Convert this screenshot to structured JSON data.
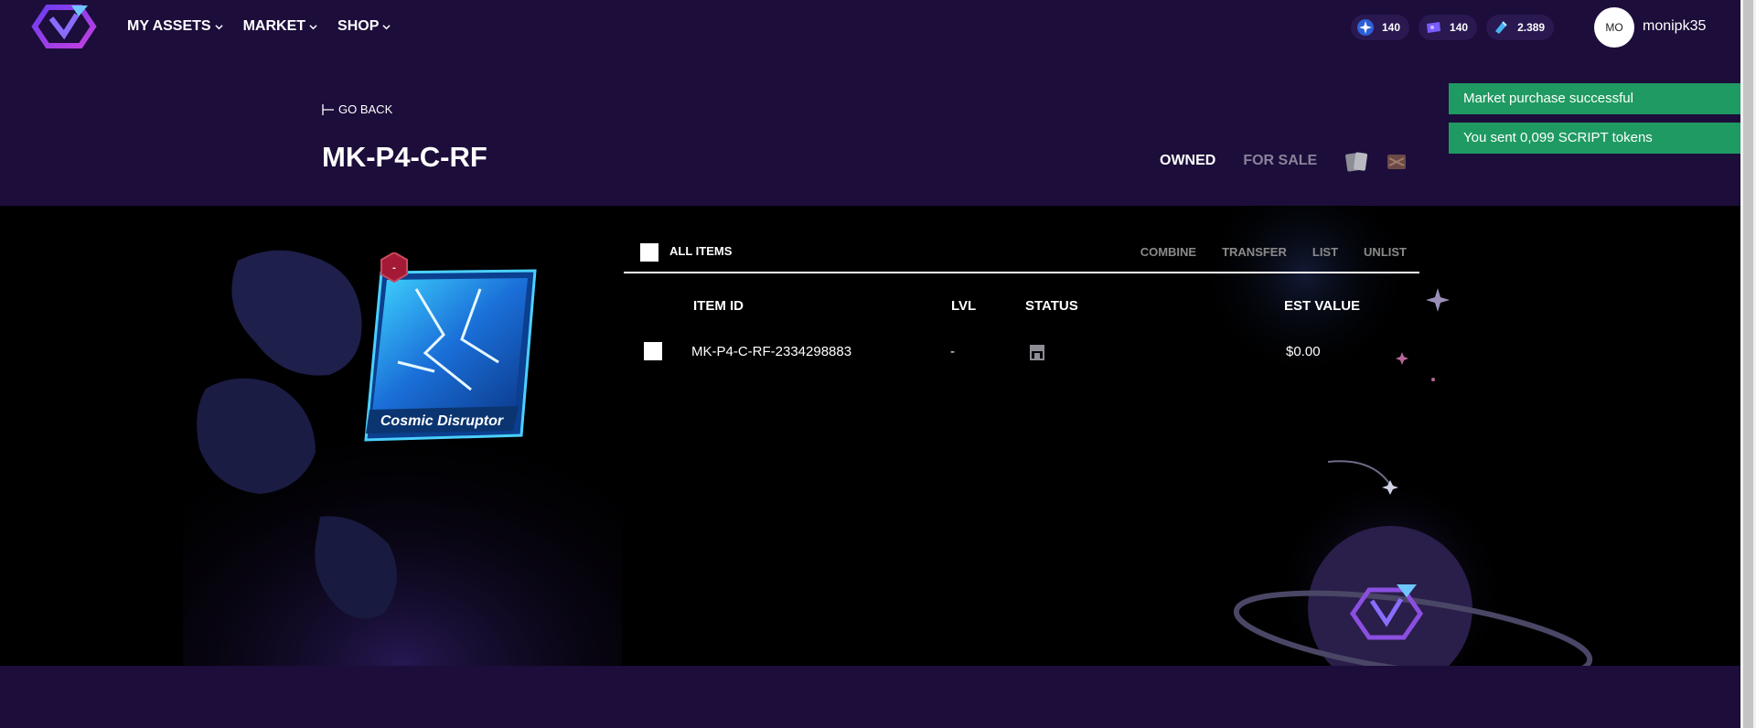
{
  "nav": {
    "items": [
      {
        "label": "MY ASSETS"
      },
      {
        "label": "MARKET"
      },
      {
        "label": "SHOP"
      }
    ]
  },
  "currencies": [
    {
      "icon": "star-token-icon",
      "value": "140"
    },
    {
      "icon": "ticket-icon",
      "value": "140"
    },
    {
      "icon": "script-token-icon",
      "value": "2.389"
    }
  ],
  "user": {
    "initials": "MO",
    "name": "monipk35"
  },
  "header": {
    "back_label": "GO BACK",
    "title": "MK-P4-C-RF",
    "filter_owned": "OWNED",
    "filter_for_sale": "FOR SALE"
  },
  "toasts": [
    "Market purchase successful",
    "You sent 0,099 SCRIPT tokens"
  ],
  "card": {
    "name": "Cosmic Disruptor",
    "badge": "-"
  },
  "toolbar": {
    "all_items_label": "ALL ITEMS",
    "actions": [
      "COMBINE",
      "TRANSFER",
      "LIST",
      "UNLIST"
    ]
  },
  "table": {
    "headers": {
      "item_id": "ITEM ID",
      "lvl": "LVL",
      "status": "STATUS",
      "est_value": "EST VALUE"
    },
    "rows": [
      {
        "item_id": "MK-P4-C-RF-2334298883",
        "lvl": "-",
        "status_icon": "store-icon",
        "est_value": "$0.00"
      }
    ]
  },
  "colors": {
    "header_bg": "#1c0d3a",
    "toast_success": "#1f9a62",
    "panel_bg": "#000000"
  }
}
